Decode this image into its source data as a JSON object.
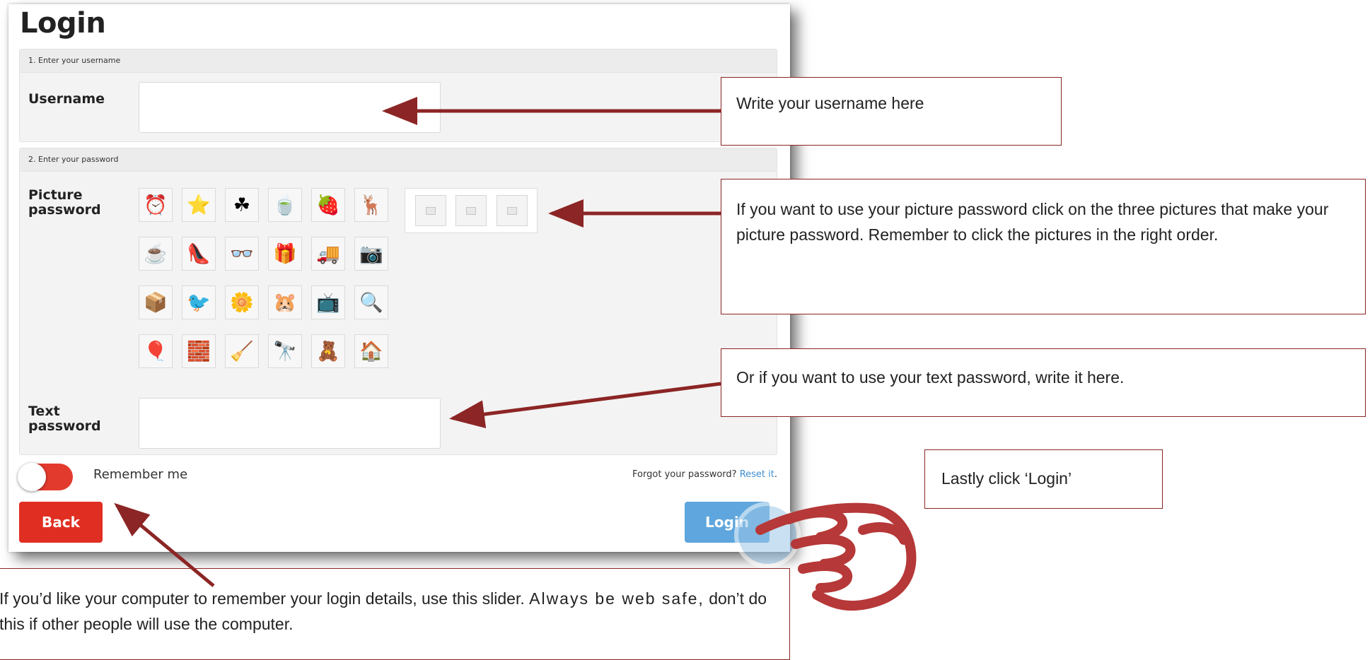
{
  "login": {
    "title": "Login",
    "step1_heading": "1. Enter your username",
    "username_label": "Username",
    "step2_heading": "2. Enter your password",
    "picture_password_label": "Picture password",
    "pictures": [
      "⏰",
      "⭐",
      "☘",
      "🍵",
      "🍓",
      "🦌",
      "☕",
      "👠",
      "👓",
      "🎁",
      "🚚",
      "📷",
      "📦",
      "🐦",
      "🌼",
      "🐹",
      "📺",
      "🔍",
      "🎈",
      "🧱",
      "🧹",
      "🔭",
      "🧸",
      "🏠"
    ],
    "text_password_label": "Text password",
    "remember_label": "Remember me",
    "forgot_text": "Forgot your password?",
    "reset_link": "Reset it",
    "reset_suffix": ".",
    "back_label": "Back",
    "login_label": "Login"
  },
  "callouts": {
    "username": "Write your username here",
    "picture": "If you want to use your picture password click on the three pictures that make your picture password. Remember to click the pictures in the right order.",
    "text_password": "Or if you want to use your text password, write it here.",
    "login": "Lastly click ‘Login’",
    "remember_part1": "If you’d like your computer to remember your login details, use this slider.",
    "remember_part2": "Always be web safe,",
    "remember_part3": "don’t do this if other people will use the computer."
  },
  "colors": {
    "accent_red": "#e02f22",
    "login_blue": "#5ea6dd",
    "arrow": "#8c2525",
    "hand": "#b63838"
  }
}
